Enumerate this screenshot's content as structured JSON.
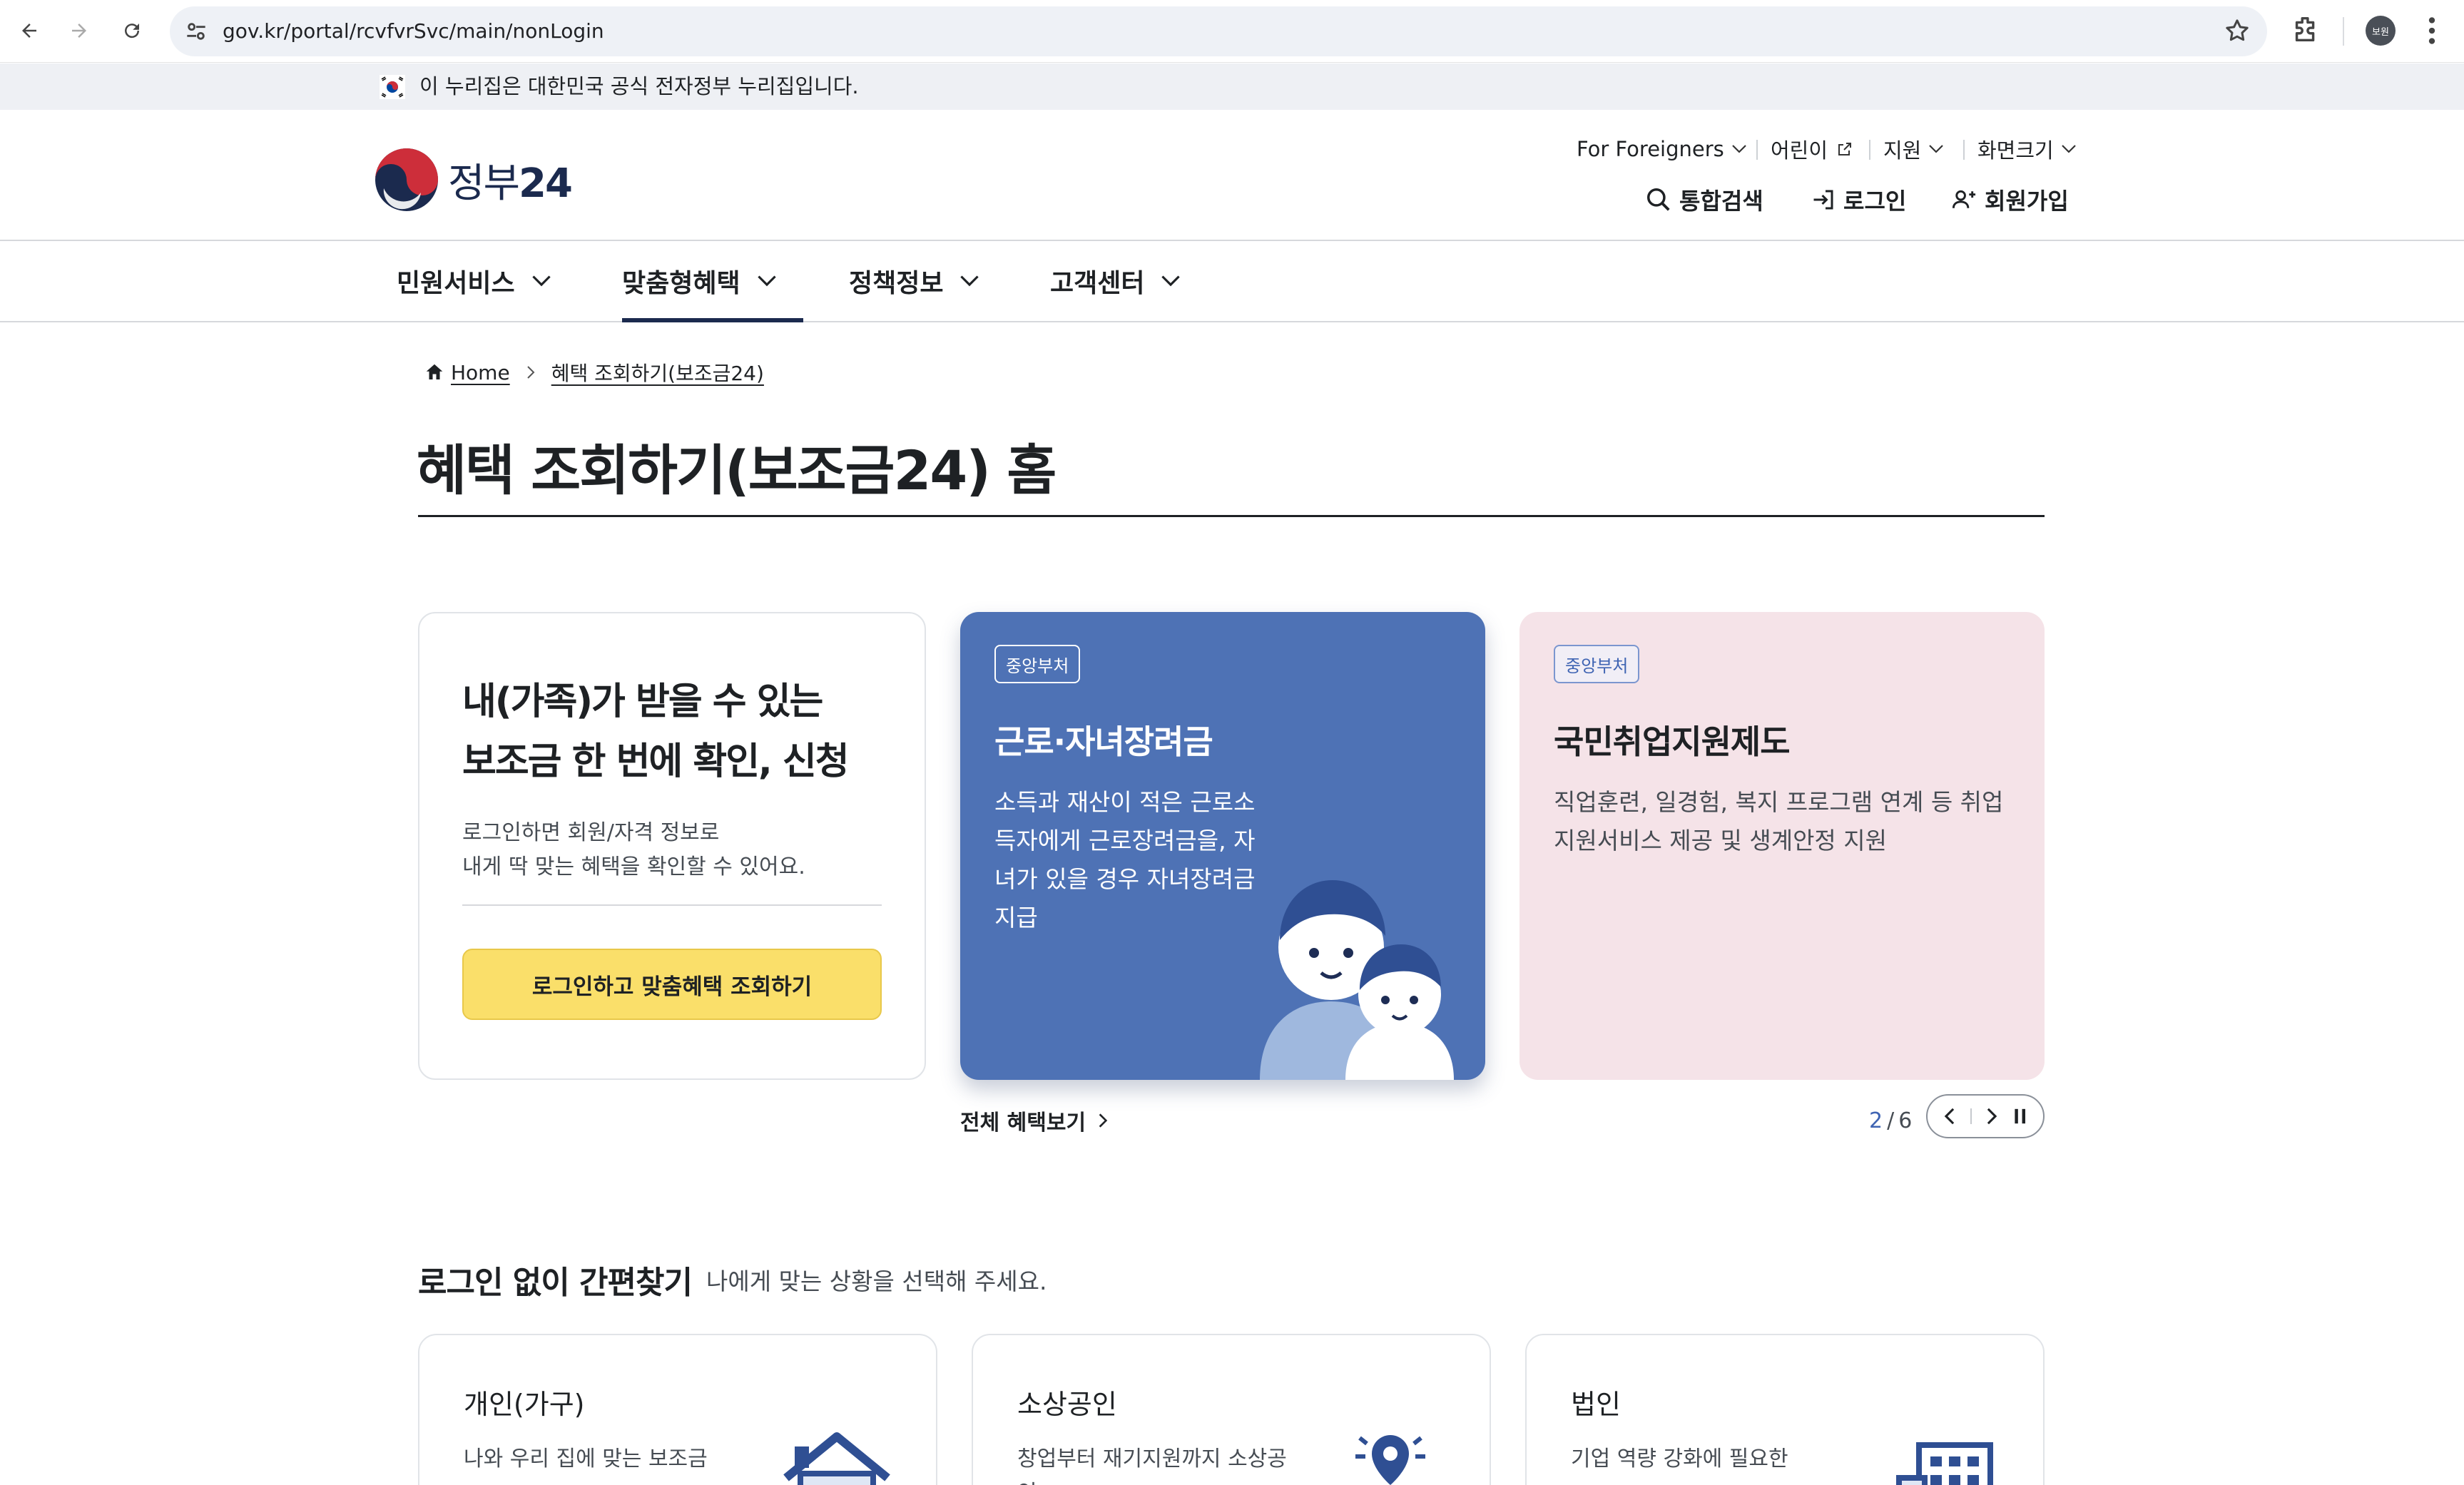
{
  "browser": {
    "url": "gov.kr/portal/rcvfvrSvc/main/nonLogin",
    "profile_label": "보원"
  },
  "gov_banner": {
    "text": "이 누리집은 대한민국 공식 전자정부 누리집입니다."
  },
  "header": {
    "logo_text": "정부",
    "logo_num": "24",
    "utility": {
      "foreigners": "For Foreigners",
      "kids": "어린이",
      "support": "지원",
      "screen_size": "화면크기"
    },
    "actions": {
      "search": "통합검색",
      "login": "로그인",
      "signup": "회원가입"
    }
  },
  "nav": {
    "items": [
      {
        "label": "민원서비스"
      },
      {
        "label": "맞춤형혜택"
      },
      {
        "label": "정책정보"
      },
      {
        "label": "고객센터"
      }
    ]
  },
  "breadcrumb": {
    "home": "Home",
    "current": "혜택 조회하기(보조금24)"
  },
  "page_title": "혜택 조회하기(보조금24) 홈",
  "login_card": {
    "headline_1": "내(가족)가 받을 수 있는",
    "headline_2": "보조금 한 번에 확인, 신청",
    "desc_1": "로그인하면 회원/자격 정보로",
    "desc_2": "내게 딱 맞는 혜택을 확인할 수 있어요.",
    "button": "로그인하고 맞춤혜택 조회하기"
  },
  "benefit_cards": [
    {
      "badge": "중앙부처",
      "title": "근로·자녀장려금",
      "desc": "소득과 재산이 적은 근로소득자에게 근로장려금을, 자녀가 있을 경우 자녀장려금 지급"
    },
    {
      "badge": "중앙부처",
      "title": "국민취업지원제도",
      "desc": "직업훈련, 일경험, 복지 프로그램 연계 등 취업지원서비스 제공 및 생계안정 지원"
    }
  ],
  "carousel": {
    "all_link": "전체 혜택보기",
    "current": "2",
    "separator": "/",
    "total": "6"
  },
  "quick_find": {
    "title": "로그인 없이 간편찾기",
    "subtitle": "나에게 맞는 상황을 선택해 주세요.",
    "cards": [
      {
        "title": "개인(가구)",
        "desc": "나와 우리 집에 맞는 보조금"
      },
      {
        "title": "소상공인",
        "desc": "창업부터 재기지원까지 소상공인"
      },
      {
        "title": "법인",
        "desc": "기업 역량 강화에 필요한"
      }
    ]
  },
  "colors": {
    "brand_navy": "#1b2a4e",
    "card_blue": "#4e72b5",
    "card_pink": "#f5e3e8",
    "button_yellow": "#fadf6a",
    "accent_blue": "#3f64b3"
  }
}
